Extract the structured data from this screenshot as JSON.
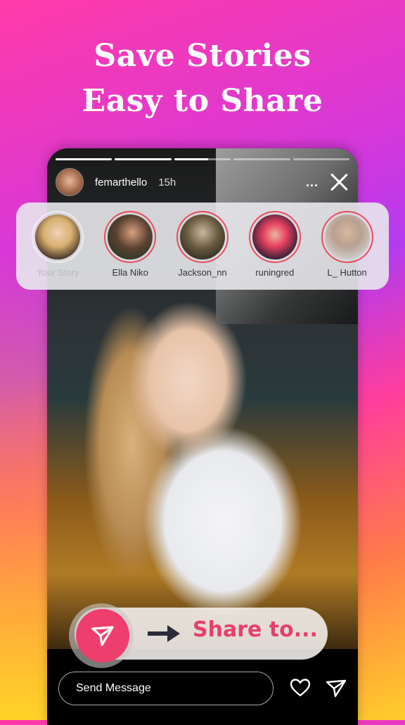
{
  "headline": {
    "line1": "Save Stories",
    "line2": "Easy to Share"
  },
  "colors": {
    "accent": "#ee3e6e",
    "share_text": "#e63f6c",
    "ring": "#e84c5c"
  },
  "story": {
    "progress_segments": [
      1,
      1,
      0.6,
      0,
      0
    ],
    "username": "femarthello",
    "time": "15h",
    "more_label": "...",
    "close_icon": "close-icon"
  },
  "tray": {
    "items": [
      {
        "label": "Your Story",
        "own": true
      },
      {
        "label": "Ella Niko",
        "own": false
      },
      {
        "label": "Jackson_nn",
        "own": false
      },
      {
        "label": "runingred",
        "own": false
      },
      {
        "label": "L_ Hutton",
        "own": false
      }
    ]
  },
  "share": {
    "label": "Share to...",
    "icon": "send-icon",
    "arrow_icon": "arrow-right-icon"
  },
  "footer": {
    "message_placeholder": "Send Message",
    "like_icon": "heart-icon",
    "send_icon": "send-icon"
  }
}
